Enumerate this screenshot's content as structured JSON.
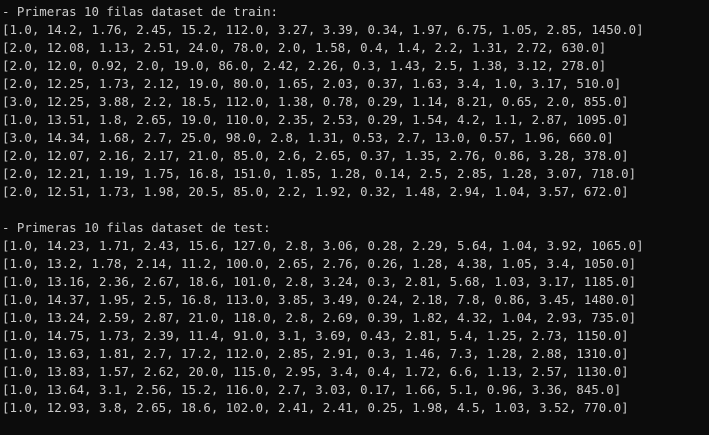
{
  "train": {
    "header": "- Primeras 10 filas dataset de train:",
    "rows": [
      "[1.0, 14.2, 1.76, 2.45, 15.2, 112.0, 3.27, 3.39, 0.34, 1.97, 6.75, 1.05, 2.85, 1450.0]",
      "[2.0, 12.08, 1.13, 2.51, 24.0, 78.0, 2.0, 1.58, 0.4, 1.4, 2.2, 1.31, 2.72, 630.0]",
      "[2.0, 12.0, 0.92, 2.0, 19.0, 86.0, 2.42, 2.26, 0.3, 1.43, 2.5, 1.38, 3.12, 278.0]",
      "[2.0, 12.25, 1.73, 2.12, 19.0, 80.0, 1.65, 2.03, 0.37, 1.63, 3.4, 1.0, 3.17, 510.0]",
      "[3.0, 12.25, 3.88, 2.2, 18.5, 112.0, 1.38, 0.78, 0.29, 1.14, 8.21, 0.65, 2.0, 855.0]",
      "[1.0, 13.51, 1.8, 2.65, 19.0, 110.0, 2.35, 2.53, 0.29, 1.54, 4.2, 1.1, 2.87, 1095.0]",
      "[3.0, 14.34, 1.68, 2.7, 25.0, 98.0, 2.8, 1.31, 0.53, 2.7, 13.0, 0.57, 1.96, 660.0]",
      "[2.0, 12.07, 2.16, 2.17, 21.0, 85.0, 2.6, 2.65, 0.37, 1.35, 2.76, 0.86, 3.28, 378.0]",
      "[2.0, 12.21, 1.19, 1.75, 16.8, 151.0, 1.85, 1.28, 0.14, 2.5, 2.85, 1.28, 3.07, 718.0]",
      "[2.0, 12.51, 1.73, 1.98, 20.5, 85.0, 2.2, 1.92, 0.32, 1.48, 2.94, 1.04, 3.57, 672.0]"
    ]
  },
  "test": {
    "header": "- Primeras 10 filas dataset de test:",
    "rows": [
      "[1.0, 14.23, 1.71, 2.43, 15.6, 127.0, 2.8, 3.06, 0.28, 2.29, 5.64, 1.04, 3.92, 1065.0]",
      "[1.0, 13.2, 1.78, 2.14, 11.2, 100.0, 2.65, 2.76, 0.26, 1.28, 4.38, 1.05, 3.4, 1050.0]",
      "[1.0, 13.16, 2.36, 2.67, 18.6, 101.0, 2.8, 3.24, 0.3, 2.81, 5.68, 1.03, 3.17, 1185.0]",
      "[1.0, 14.37, 1.95, 2.5, 16.8, 113.0, 3.85, 3.49, 0.24, 2.18, 7.8, 0.86, 3.45, 1480.0]",
      "[1.0, 13.24, 2.59, 2.87, 21.0, 118.0, 2.8, 2.69, 0.39, 1.82, 4.32, 1.04, 2.93, 735.0]",
      "[1.0, 14.75, 1.73, 2.39, 11.4, 91.0, 3.1, 3.69, 0.43, 2.81, 5.4, 1.25, 2.73, 1150.0]",
      "[1.0, 13.63, 1.81, 2.7, 17.2, 112.0, 2.85, 2.91, 0.3, 1.46, 7.3, 1.28, 2.88, 1310.0]",
      "[1.0, 13.83, 1.57, 2.62, 20.0, 115.0, 2.95, 3.4, 0.4, 1.72, 6.6, 1.13, 2.57, 1130.0]",
      "[1.0, 13.64, 3.1, 2.56, 15.2, 116.0, 2.7, 3.03, 0.17, 1.66, 5.1, 0.96, 3.36, 845.0]",
      "[1.0, 12.93, 3.8, 2.65, 18.6, 102.0, 2.41, 2.41, 0.25, 1.98, 4.5, 1.03, 3.52, 770.0]"
    ]
  }
}
